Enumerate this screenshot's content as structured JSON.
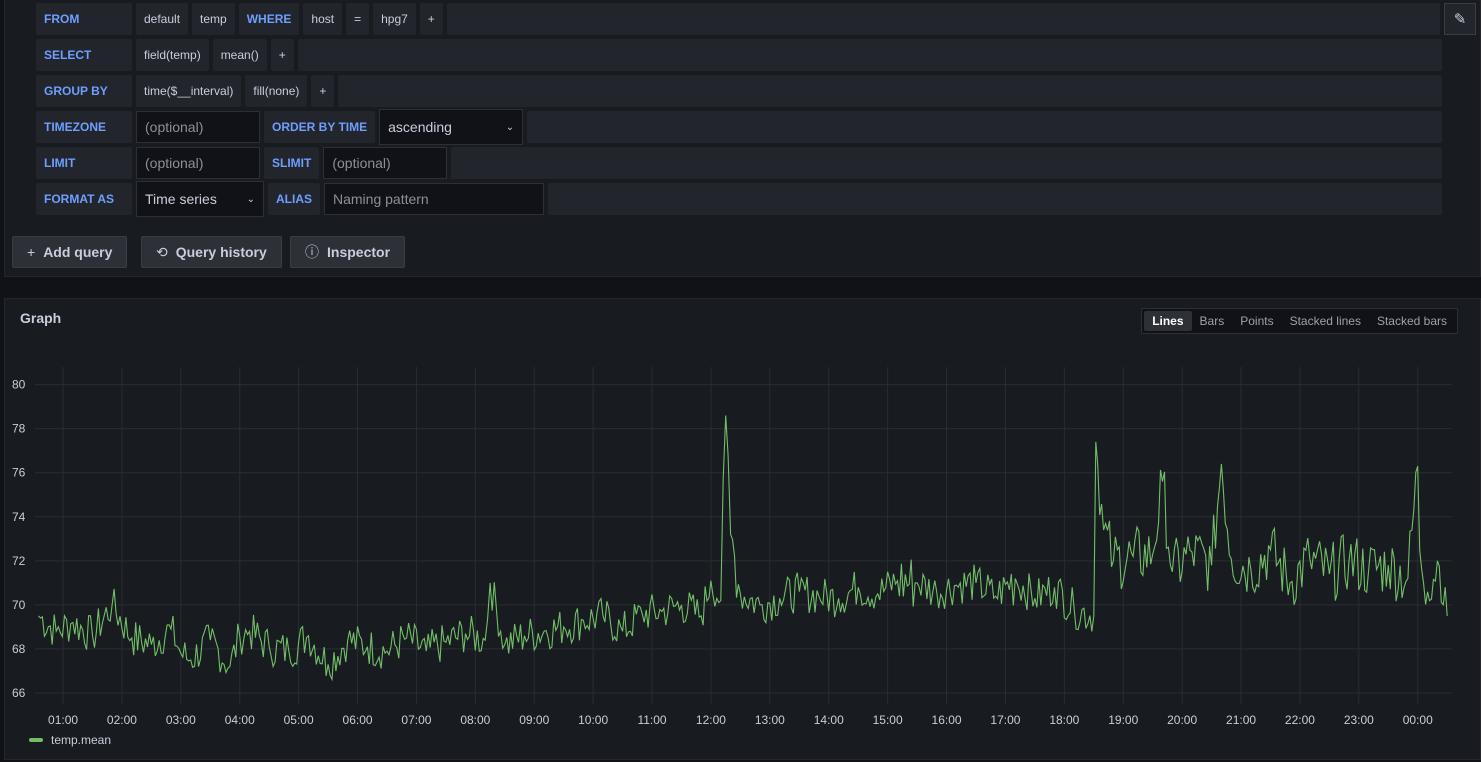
{
  "query": {
    "from": {
      "kw": "FROM",
      "db": "default",
      "measurement": "temp",
      "where_kw": "WHERE",
      "tag": "host",
      "op": "=",
      "value": "hpg7",
      "plus": "+"
    },
    "select": {
      "kw": "SELECT",
      "field": "field(temp)",
      "fn": "mean()",
      "plus": "+"
    },
    "group_by": {
      "kw": "GROUP BY",
      "time": "time($__interval)",
      "fill": "fill(none)",
      "plus": "+"
    },
    "timezone": {
      "kw": "TIMEZONE",
      "placeholder": "(optional)",
      "order_kw": "ORDER BY TIME",
      "order_value": "ascending"
    },
    "limit": {
      "kw": "LIMIT",
      "placeholder": "(optional)",
      "slimit_kw": "SLIMIT",
      "slimit_placeholder": "(optional)"
    },
    "format": {
      "kw": "FORMAT AS",
      "value": "Time series",
      "alias_kw": "ALIAS",
      "alias_placeholder": "Naming pattern"
    }
  },
  "actions": {
    "add_query": "Add query",
    "query_history": "Query history",
    "inspector": "Inspector"
  },
  "graph": {
    "title": "Graph",
    "modes": [
      "Lines",
      "Bars",
      "Points",
      "Stacked lines",
      "Stacked bars"
    ],
    "active_mode": "Lines"
  },
  "chart_data": {
    "type": "line",
    "title": "",
    "xlabel": "",
    "ylabel": "",
    "ylim": [
      65.5,
      80.8
    ],
    "y_ticks": [
      66,
      68,
      70,
      72,
      74,
      76,
      78,
      80
    ],
    "x_ticks": [
      "01:00",
      "02:00",
      "03:00",
      "04:00",
      "05:00",
      "06:00",
      "07:00",
      "08:00",
      "09:00",
      "10:00",
      "11:00",
      "12:00",
      "13:00",
      "14:00",
      "15:00",
      "16:00",
      "17:00",
      "18:00",
      "19:00",
      "20:00",
      "21:00",
      "22:00",
      "23:00",
      "00:00"
    ],
    "grid": true,
    "legend": "bottom-left",
    "color": "#73bf69",
    "series": [
      {
        "name": "temp.mean",
        "x": [
          "00:35",
          "00:53",
          "01:10",
          "01:30",
          "01:50",
          "02:10",
          "02:30",
          "02:50",
          "03:00",
          "03:10",
          "03:30",
          "03:50",
          "04:00",
          "04:10",
          "04:30",
          "04:50",
          "05:10",
          "05:30",
          "05:50",
          "06:10",
          "06:30",
          "06:50",
          "07:10",
          "07:30",
          "07:50",
          "08:10",
          "08:15",
          "08:30",
          "08:50",
          "09:10",
          "09:30",
          "09:50",
          "10:10",
          "10:30",
          "10:50",
          "11:10",
          "11:30",
          "11:50",
          "12:00",
          "12:10",
          "12:15",
          "12:20",
          "12:30",
          "12:50",
          "13:10",
          "13:30",
          "13:50",
          "14:10",
          "14:30",
          "14:50",
          "15:10",
          "15:30",
          "15:50",
          "16:10",
          "16:30",
          "16:50",
          "17:10",
          "17:30",
          "17:50",
          "18:10",
          "18:30",
          "18:32",
          "18:40",
          "18:50",
          "19:10",
          "19:30",
          "19:40",
          "19:50",
          "20:10",
          "20:30",
          "20:40",
          "20:50",
          "21:10",
          "21:30",
          "21:50",
          "22:10",
          "22:30",
          "22:50",
          "23:10",
          "23:30",
          "23:50",
          "00:00",
          "00:02",
          "00:10",
          "00:20",
          "00:30"
        ],
        "y": [
          69.5,
          68.8,
          69.2,
          68.6,
          70.0,
          68.5,
          68.2,
          68.9,
          67.8,
          67.5,
          68.4,
          67.2,
          68.6,
          68.8,
          68.1,
          67.9,
          68.6,
          67.3,
          68.4,
          68.1,
          67.9,
          68.5,
          67.9,
          68.3,
          68.7,
          68.4,
          71.0,
          68.2,
          68.6,
          68.8,
          69.0,
          69.3,
          69.5,
          68.8,
          69.6,
          69.7,
          70.0,
          69.5,
          71.1,
          70.2,
          78.6,
          73.2,
          70.5,
          70.0,
          70.3,
          70.6,
          70.4,
          70.3,
          70.8,
          70.5,
          71.1,
          71.0,
          70.6,
          70.9,
          71.0,
          70.4,
          71.2,
          70.3,
          70.8,
          69.8,
          69.5,
          77.4,
          73.4,
          72.0,
          72.2,
          72.3,
          75.6,
          71.5,
          72.4,
          71.8,
          76.4,
          72.1,
          71.6,
          72.5,
          71.0,
          72.1,
          71.4,
          72.0,
          71.6,
          71.8,
          71.2,
          76.3,
          72.5,
          70.6,
          72.0,
          69.5
        ]
      }
    ]
  }
}
